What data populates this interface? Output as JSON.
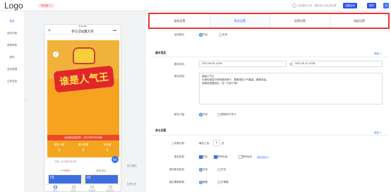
{
  "header": {
    "logo": "Logo",
    "badge": "专业版 ∨",
    "tip": "活动展开过多，跟进用人员后待处理",
    "btn1": "创建活动",
    "btn2": "操作"
  },
  "sidebar": {
    "items": [
      "首页",
      "活动列表",
      "参赛审核",
      "我的",
      "活动数据",
      "主体信息"
    ]
  },
  "preview": {
    "status_time": "9:41 AM",
    "title": "参与活动赢大奖",
    "poster_text": "谁是人气王",
    "countdown": "活动距结束还有：4天23时59分59秒",
    "stats": [
      {
        "label": "报名人数",
        "value": "0"
      },
      {
        "label": "累计投票",
        "value": "0"
      },
      {
        "label": "访问量",
        "value": "0"
      }
    ],
    "search_placeholder": "请输入选手编号或名称",
    "fab": "报名",
    "tab_a": "人气排行",
    "tab_b": "最新报名",
    "card_a": "03",
    "card_b": "03",
    "bottom": [
      "首页",
      "排行榜",
      "活动规则",
      "我的报名"
    ],
    "side_notes": [
      "报名编辑",
      "投票记录"
    ]
  },
  "tabs": [
    "基础设置",
    "报名设置",
    "投票设置",
    "高级设置"
  ],
  "form": {
    "signup_switch_label": "活动报名:",
    "signup_on": "开启",
    "signup_off": "关闭",
    "basic_title": "基本信息",
    "more1": "收起 ∨",
    "time_label": "报名时间:",
    "time_start": "2021-08-05 14:58",
    "time_sep": "至",
    "time_end": "2021-08-12 14:58",
    "desc_label": "报名须知:",
    "desc_lines": [
      "温馨人气王",
      "大家的报名时间有限的两个，看看谁的人气最高，最受欢迎。",
      "参赛信息要真实，另一分钟了哦?"
    ],
    "threshold_label": "报名门槛:",
    "thr_off": "关闭",
    "thr_on": "限制用户参与",
    "participate_title": "参与设置",
    "more2": "收起 ∨",
    "limit_label": "上传照片数:",
    "limit_prefix": "最多上传",
    "limit_value": "6",
    "limit_suffix": "张",
    "fields_label": "报名信息:",
    "f1": "姓名",
    "f2": "联系电话",
    "f3": "联系地址",
    "f_add": "添加自定义",
    "review_label": "电话报名验证:",
    "review_on": "关闭",
    "review_off": "开启",
    "audit_label": "报名需要审核:",
    "audit_a": "需要",
    "audit_b": "不需要"
  }
}
